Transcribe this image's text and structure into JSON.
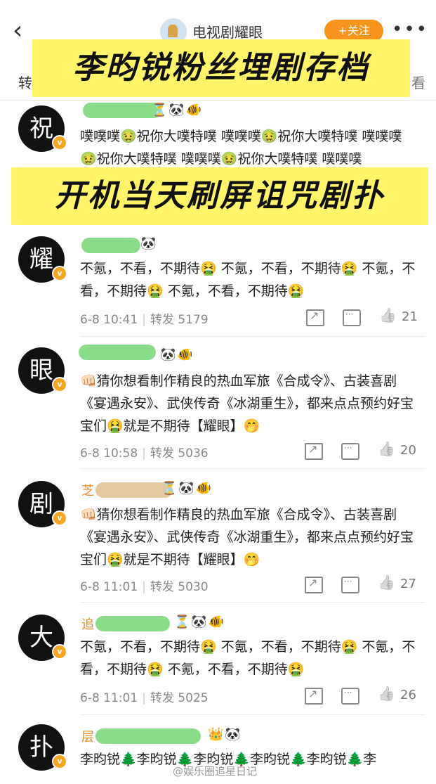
{
  "topbar": {
    "back_icon": "chevron-left-icon",
    "account_name": "电视剧耀眼",
    "follow_label": "+关注",
    "more_icon": "more-icon",
    "tab_left": "转",
    "tab_right": "看"
  },
  "banners": {
    "top": "李昀锐粉丝埋剧存档",
    "middle": "开机当天刷屏诅咒剧扑"
  },
  "posts": [
    {
      "avatar_char": "祝",
      "badges": "⏳🐼🐠",
      "text": "噗噗噗🤢祝你大噗特噗 噗噗噗🤢祝你大噗特噗 噗噗噗🤢祝你大噗特噗 噗噗噗🤢祝你大噗特噗 噗噗噗"
    },
    {
      "avatar_char": "耀",
      "badges": "🐼",
      "text": "不氪，不看，不期待🤮 不氪，不看，不期待🤮 不氪，不看，不期待🤮 不氪，不看，不期待🤮",
      "time": "6-8 10:41",
      "repost": "转发 5179",
      "likes": "21"
    },
    {
      "avatar_char": "眼",
      "badges": "🐼🐠",
      "text": "👊🏻猜你想看制作精良的热血军旅《合成令》、古装喜剧《宴遇永安》、武侠传奇《冰湖重生》，都来点点预约好宝宝们🤮就是不期待【耀眼】🤭",
      "time": "6-8 10:58",
      "repost": "转发 5036",
      "likes": "20"
    },
    {
      "avatar_char": "剧",
      "name_frag": "芝",
      "badges": "⏳🐼🐠",
      "text": "👊🏻猜你想看制作精良的热血军旅《合成令》、古装喜剧《宴遇永安》、武侠传奇《冰湖重生》，都来点点预约好宝宝们🤮就是不期待【耀眼】🤭",
      "time": "6-8 11:01",
      "repost": "转发 5030",
      "likes": "27"
    },
    {
      "avatar_char": "大",
      "name_frag": "追",
      "badges": "⏳🐼🐠",
      "text": "不氪，不看，不期待🤮 不氪，不看，不期待🤮 不氪，不看，不期待🤮 不氪，不看，不期待🤮",
      "time": "6-8 11:01",
      "repost": "转发 5025",
      "likes": "26"
    },
    {
      "avatar_char": "扑",
      "name_frag": "层",
      "badges": "👑🐼",
      "text": "李昀锐🌲李昀锐🌲李昀锐🌲李昀锐🌲李昀锐🌲李"
    }
  ],
  "watermark": "@娱乐圈追星日记"
}
